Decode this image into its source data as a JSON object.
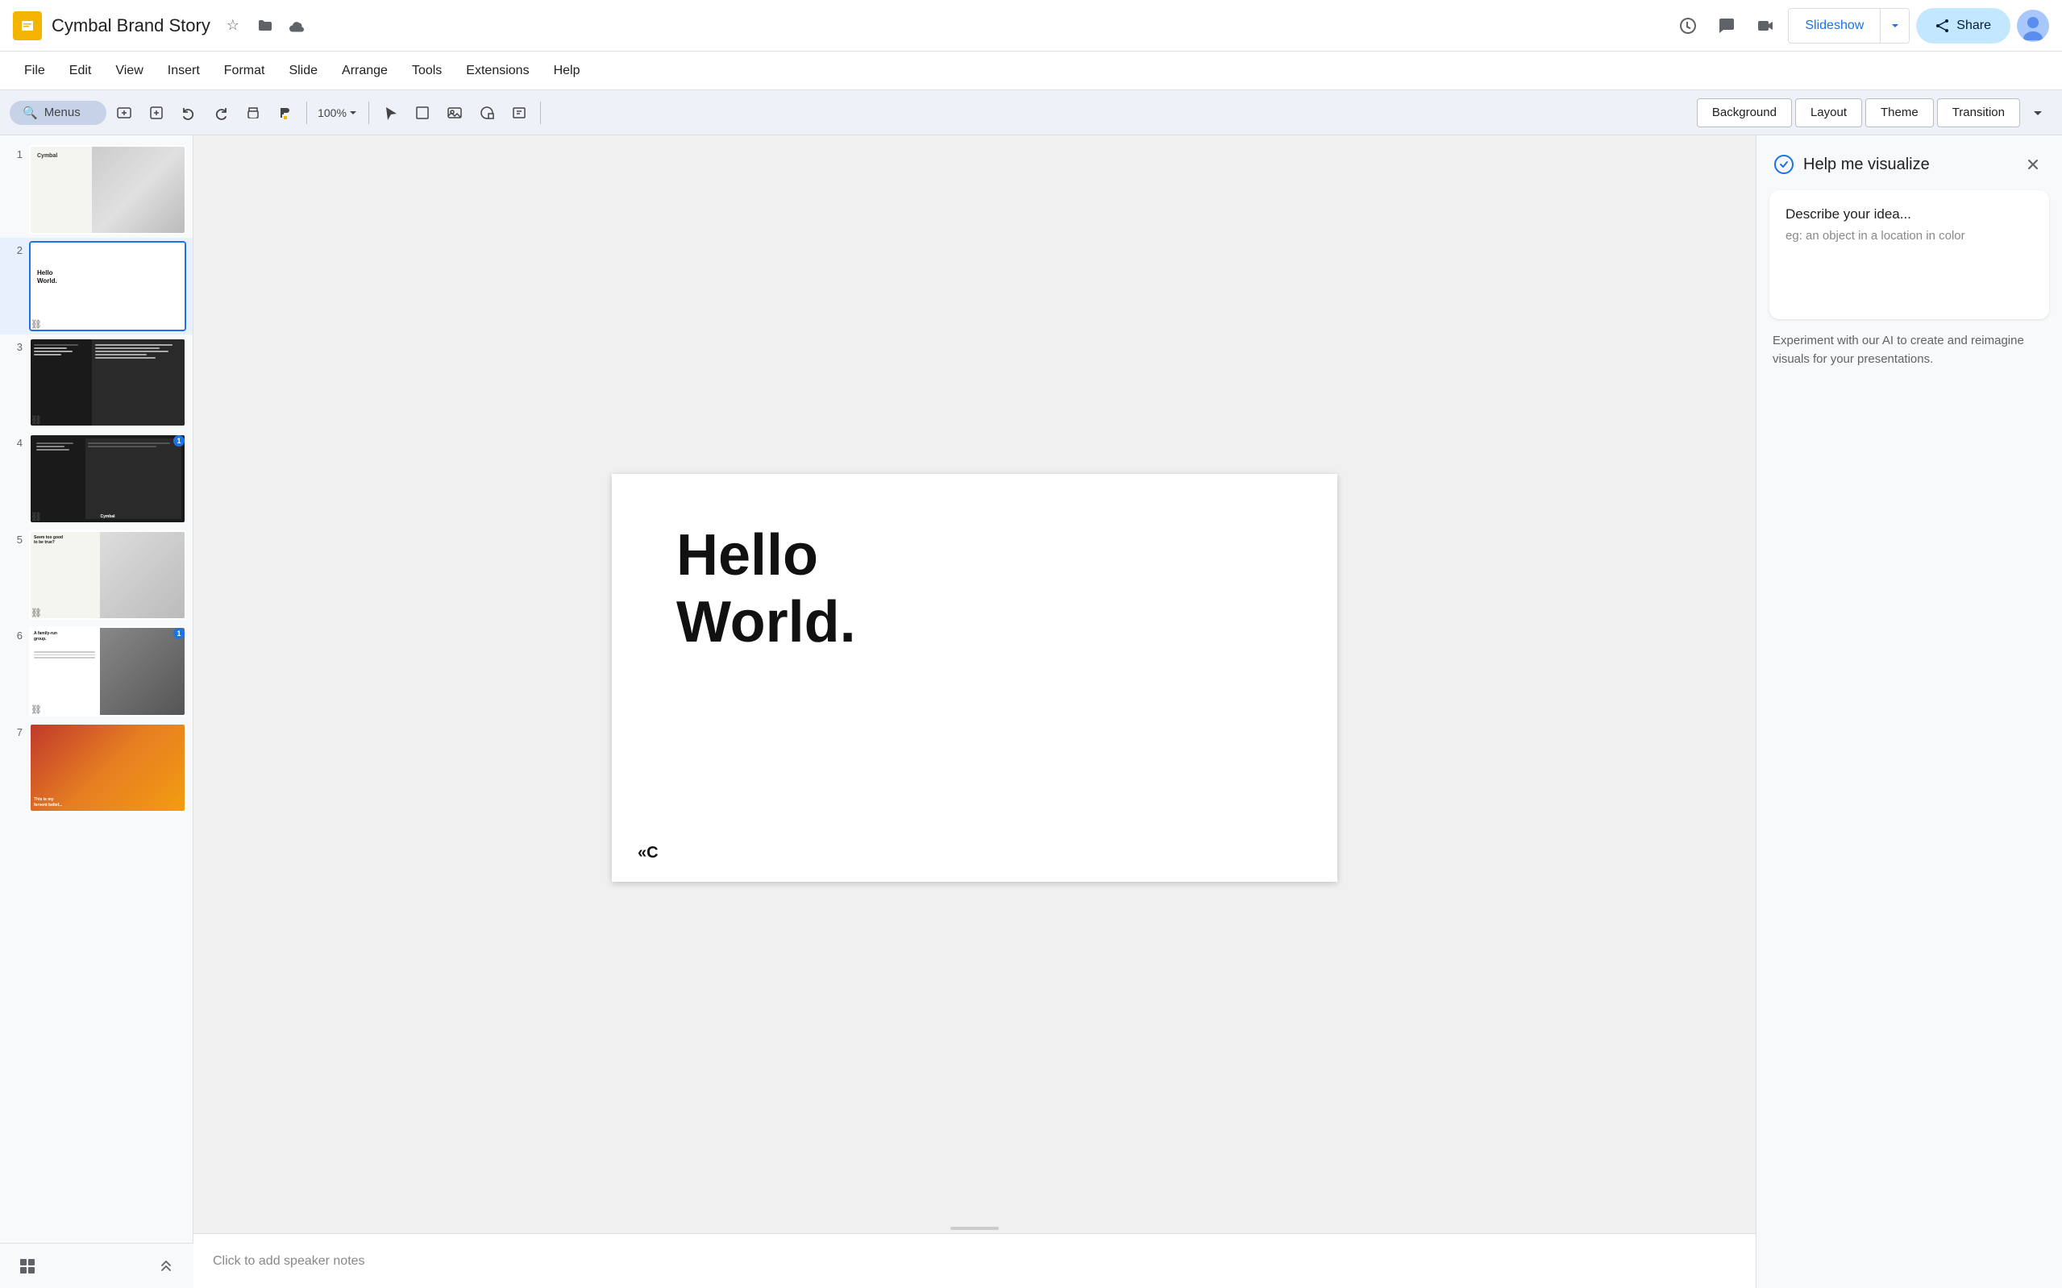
{
  "app": {
    "icon_color": "#f4b400",
    "title": "Cymbal Brand Story",
    "star_icon": "★",
    "folder_icon": "🗀",
    "cloud_icon": "☁"
  },
  "menu": {
    "file": "File",
    "edit": "Edit",
    "view": "View",
    "insert": "Insert",
    "format": "Format",
    "slide": "Slide",
    "arrange": "Arrange",
    "tools": "Tools",
    "extensions": "Extensions",
    "help": "Help"
  },
  "toolbar": {
    "search_label": "Menus",
    "search_icon": "🔍"
  },
  "toolbar_actions": {
    "background": "Background",
    "layout": "Layout",
    "theme": "Theme",
    "transition": "Transition"
  },
  "slideshow": {
    "button_label": "Slideshow"
  },
  "share": {
    "button_label": "Share"
  },
  "slides": [
    {
      "number": "1",
      "type": "cymbal-brand",
      "has_link": false
    },
    {
      "number": "2",
      "type": "hello-world",
      "active": true,
      "has_link": true
    },
    {
      "number": "3",
      "type": "dark-layout",
      "has_link": true
    },
    {
      "number": "4",
      "type": "cymbal-dark",
      "has_link": true,
      "badge": "1"
    },
    {
      "number": "5",
      "type": "seem-too-good",
      "has_link": true
    },
    {
      "number": "6",
      "type": "family-run",
      "has_link": true,
      "badge": "1"
    },
    {
      "number": "7",
      "type": "sunset",
      "has_link": false
    }
  ],
  "main_slide": {
    "text_line1": "Hello",
    "text_line2": "World.",
    "footer_logo": "«C"
  },
  "speaker_notes": {
    "placeholder": "Click to add speaker notes"
  },
  "right_panel": {
    "title": "Help me visualize",
    "idea_placeholder": "Describe your idea...",
    "idea_hint": "eg: an object in a location in color",
    "description": "Experiment with our AI to create and reimagine visuals for your presentations."
  }
}
